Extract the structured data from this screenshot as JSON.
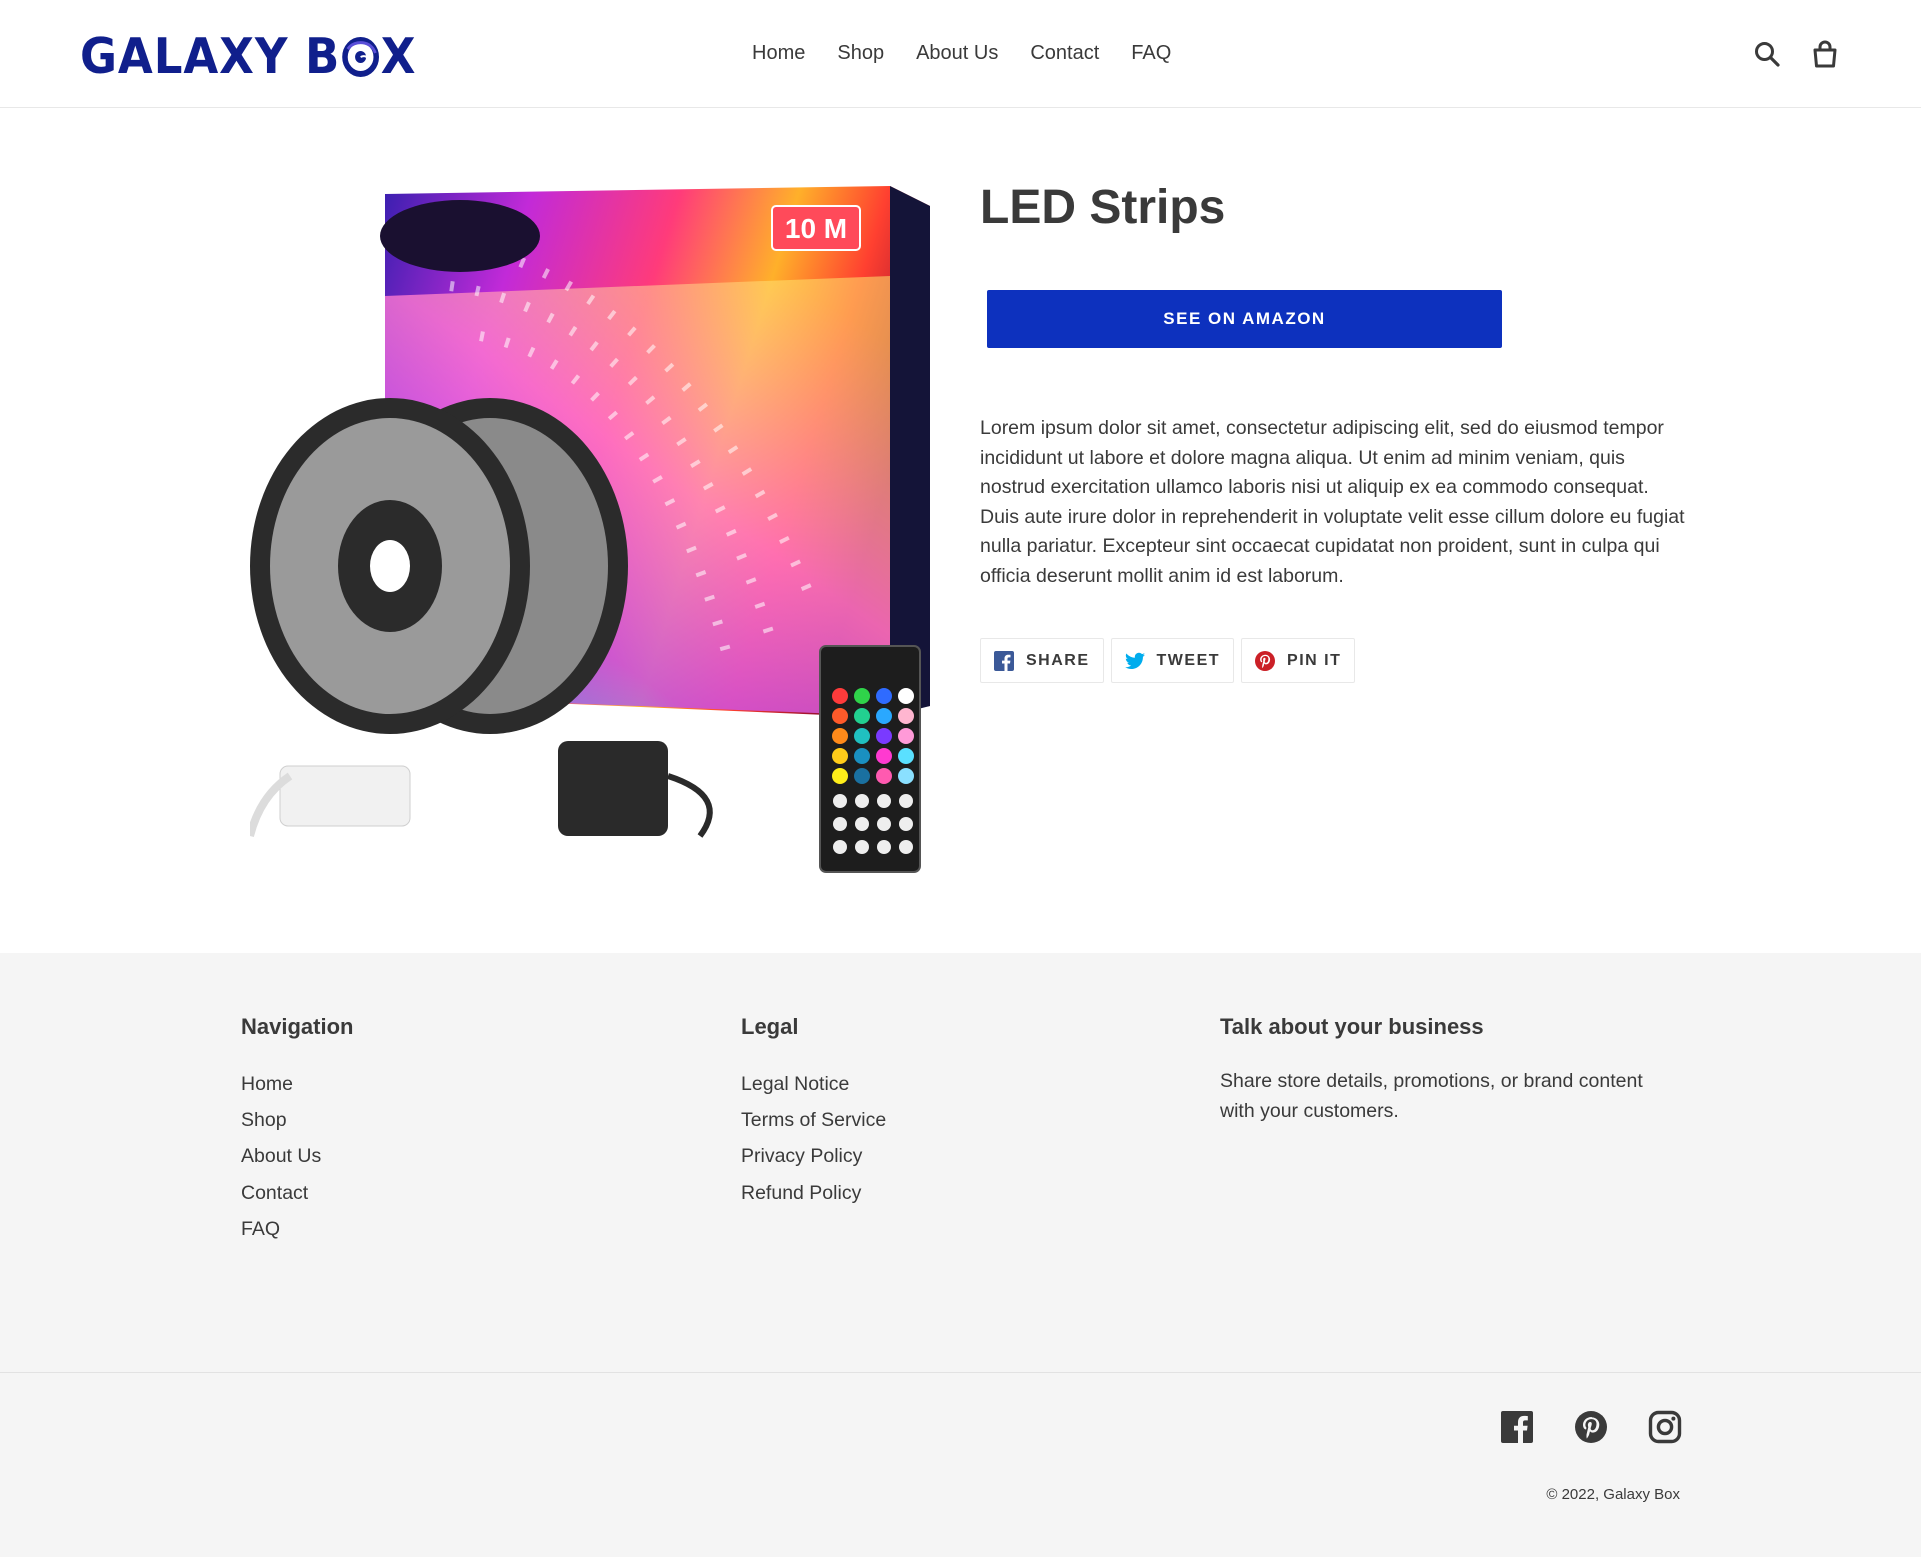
{
  "header": {
    "logo_text_left": "GALAXY B",
    "logo_text_right": "X",
    "nav": [
      "Home",
      "Shop",
      "About Us",
      "Contact",
      "FAQ"
    ],
    "icons": [
      "search-icon",
      "cart-icon"
    ]
  },
  "product": {
    "title": "LED Strips",
    "image_badge": "10 M",
    "buy_label": "SEE ON AMAZON",
    "description": "Lorem ipsum dolor sit amet, consectetur adipiscing elit, sed do eiusmod tempor incididunt ut labore et dolore magna aliqua. Ut enim ad minim veniam, quis nostrud exercitation ullamco laboris nisi ut aliquip ex ea commodo consequat. Duis aute irure dolor in reprehenderit in voluptate velit esse cillum dolore eu fugiat nulla pariatur. Excepteur sint occaecat cupidatat non proident, sunt in culpa qui officia deserunt mollit anim id est laborum.",
    "share": [
      {
        "label": "SHARE",
        "icon": "facebook-icon",
        "color": "#3b5998"
      },
      {
        "label": "TWEET",
        "icon": "twitter-icon",
        "color": "#00aced"
      },
      {
        "label": "PIN IT",
        "icon": "pinterest-icon",
        "color": "#cb2027"
      }
    ]
  },
  "footer": {
    "navigation": {
      "heading": "Navigation",
      "links": [
        "Home",
        "Shop",
        "About Us",
        "Contact",
        "FAQ"
      ]
    },
    "legal": {
      "heading": "Legal",
      "links": [
        "Legal Notice",
        "Terms of Service",
        "Privacy Policy",
        "Refund Policy"
      ]
    },
    "business": {
      "heading": "Talk about your business",
      "text": "Share store details, promotions, or brand content with your customers."
    },
    "social_icons": [
      "facebook-icon",
      "pinterest-icon",
      "instagram-icon"
    ],
    "copyright": "© 2022, Galaxy Box"
  },
  "colors": {
    "brand": "#101f8c",
    "button": "#0d31be",
    "footer_bg": "#f5f5f5",
    "text": "#3a3a3a"
  }
}
